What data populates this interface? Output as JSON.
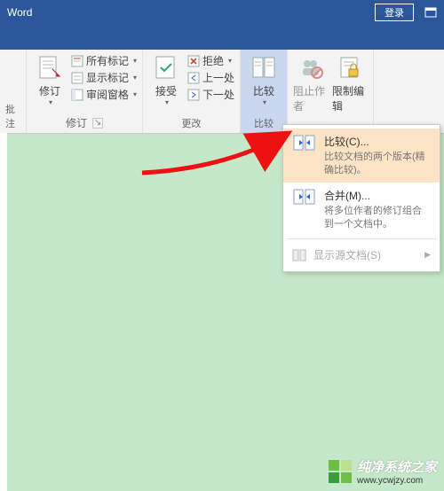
{
  "titlebar": {
    "app": "Word",
    "login": "登录"
  },
  "ribbon": {
    "revisions": {
      "label": "修订",
      "big": "修订",
      "all_markup": "所有标记",
      "show_markup": "显示标记",
      "review_pane": "审阅窗格"
    },
    "changes": {
      "label": "更改",
      "accept": "接受",
      "reject": "拒绝",
      "prev": "上一处",
      "next": "下一处"
    },
    "compare": {
      "label": "比较",
      "big": "比较"
    },
    "protect": {
      "block_author": "阻止作者",
      "restrict_editing": "限制编辑"
    },
    "partial_group": "批注"
  },
  "dropdown": {
    "compare": {
      "title": "比较(C)...",
      "desc": "比较文档的两个版本(精确比较)。"
    },
    "combine": {
      "title": "合并(M)...",
      "desc": "将多位作者的修订组合到一个文档中。"
    },
    "source": "显示源文档(S)"
  },
  "watermark": {
    "title": "纯净系统之家",
    "url": "www.ycwjzy.com"
  }
}
